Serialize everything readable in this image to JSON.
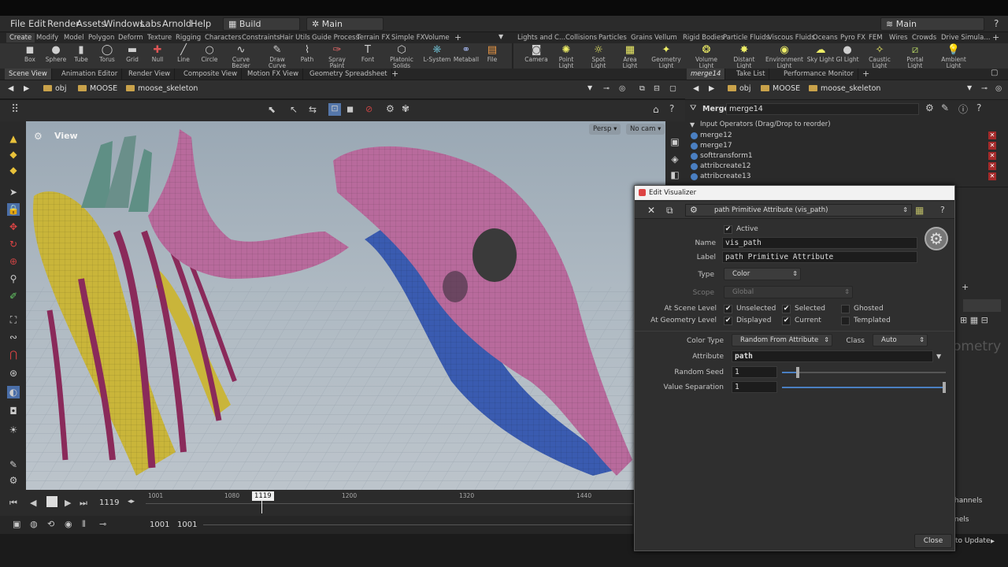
{
  "menubar": {
    "items": [
      "File",
      "Edit",
      "Render",
      "Assets",
      "Windows",
      "Labs",
      "Arnold",
      "Help"
    ],
    "desktop": "Build",
    "main": "Main",
    "right_main": "Main"
  },
  "shelf_tabs_left": [
    "Create",
    "Modify",
    "Model",
    "Polygon",
    "Deform",
    "Texture",
    "Rigging",
    "Characters",
    "Constraints",
    "Hair Utils",
    "Guide Process",
    "Terrain FX",
    "Simple FX",
    "Volume"
  ],
  "shelf_tabs_right": [
    "Lights and C...",
    "Collisions",
    "Particles",
    "Grains",
    "Vellum",
    "Rigid Bodies",
    "Particle Fluids",
    "Viscous Fluids",
    "Oceans",
    "Pyro FX",
    "FEM",
    "Wires",
    "Crowds",
    "Drive Simula..."
  ],
  "tools_left": [
    {
      "label": "Box",
      "icon": "cube-icon"
    },
    {
      "label": "Sphere",
      "icon": "sphere-icon"
    },
    {
      "label": "Tube",
      "icon": "tube-icon"
    },
    {
      "label": "Torus",
      "icon": "torus-icon"
    },
    {
      "label": "Grid",
      "icon": "grid-icon"
    },
    {
      "label": "Null",
      "icon": "null-icon"
    },
    {
      "label": "Line",
      "icon": "line-icon"
    },
    {
      "label": "Circle",
      "icon": "circle-icon"
    },
    {
      "label": "Curve Bezier",
      "icon": "curve-bezier-icon"
    },
    {
      "label": "Draw Curve",
      "icon": "draw-curve-icon"
    },
    {
      "label": "Path",
      "icon": "path-icon"
    },
    {
      "label": "Spray Paint",
      "icon": "spray-paint-icon"
    },
    {
      "label": "Font",
      "icon": "font-icon"
    },
    {
      "label": "Platonic Solids",
      "icon": "platonic-icon"
    },
    {
      "label": "L-System",
      "icon": "lsystem-icon"
    },
    {
      "label": "Metaball",
      "icon": "metaball-icon"
    },
    {
      "label": "File",
      "icon": "file-icon"
    }
  ],
  "tools_right": [
    {
      "label": "Camera",
      "icon": "camera-icon"
    },
    {
      "label": "Point Light",
      "icon": "point-light-icon"
    },
    {
      "label": "Spot Light",
      "icon": "spot-light-icon"
    },
    {
      "label": "Area Light",
      "icon": "area-light-icon"
    },
    {
      "label": "Geometry Light",
      "icon": "geometry-light-icon"
    },
    {
      "label": "Volume Light",
      "icon": "volume-light-icon"
    },
    {
      "label": "Distant Light",
      "icon": "distant-light-icon"
    },
    {
      "label": "Environment Light",
      "icon": "environment-light-icon"
    },
    {
      "label": "Sky Light",
      "icon": "sky-light-icon"
    },
    {
      "label": "GI Light",
      "icon": "gi-light-icon"
    },
    {
      "label": "Caustic Light",
      "icon": "caustic-light-icon"
    },
    {
      "label": "Portal Light",
      "icon": "portal-light-icon"
    },
    {
      "label": "Ambient Light",
      "icon": "ambient-light-icon"
    }
  ],
  "pane_tabs": [
    "Scene View",
    "Animation Editor",
    "Render View",
    "Composite View",
    "Motion FX View",
    "Geometry Spreadsheet"
  ],
  "right_pane_tabs": [
    "merge14",
    "Take List",
    "Performance Monitor"
  ],
  "path": {
    "obj": "obj",
    "moose": "MOOSE",
    "skel": "moose_skeleton"
  },
  "viewport": {
    "title": "View",
    "persp": "Persp",
    "cam": "No cam"
  },
  "merge": {
    "type": "Merge",
    "name": "merge14",
    "header": "Input Operators (Drag/Drop to reorder)",
    "inputs": [
      "merge12",
      "merge17",
      "softtransform1",
      "attribcreate12",
      "attribcreate13"
    ]
  },
  "dialog": {
    "title": "Edit Visualizer",
    "selector": "path Primitive Attribute (vis_path)",
    "active": "Active",
    "name_label": "Name",
    "name_value": "vis_path",
    "label_label": "Label",
    "label_value": "path Primitive Attribute",
    "type_label": "Type",
    "type_value": "Color",
    "scope_label": "Scope",
    "scope_value": "Global",
    "scene_level": "At Scene Level",
    "geo_level": "At Geometry Level",
    "unselected": "Unselected",
    "selected": "Selected",
    "ghosted": "Ghosted",
    "displayed": "Displayed",
    "current": "Current",
    "templated": "Templated",
    "color_type_label": "Color Type",
    "color_type_value": "Random From Attribute",
    "class_label": "Class",
    "class_value": "Auto",
    "attribute_label": "Attribute",
    "attribute_value": "path",
    "seed_label": "Random Seed",
    "seed_value": "1",
    "sep_label": "Value Separation",
    "sep_value": "1",
    "close": "Close"
  },
  "timeline": {
    "frame": "1119",
    "ticks": [
      "1001",
      "1080",
      "1200",
      "1320",
      "1440"
    ],
    "start": "1001",
    "end": "1001"
  },
  "right_lower": {
    "geometry": "ometry",
    "channels": "hannels",
    "nels": "nels",
    "update": "to Update"
  },
  "colors": {
    "accent": "#4a7fc1",
    "pink": "#b86a9c",
    "blue": "#3a5bb0",
    "yellow": "#c9b53a",
    "maroon": "#8a2a5a",
    "teal": "#5f8f85"
  }
}
